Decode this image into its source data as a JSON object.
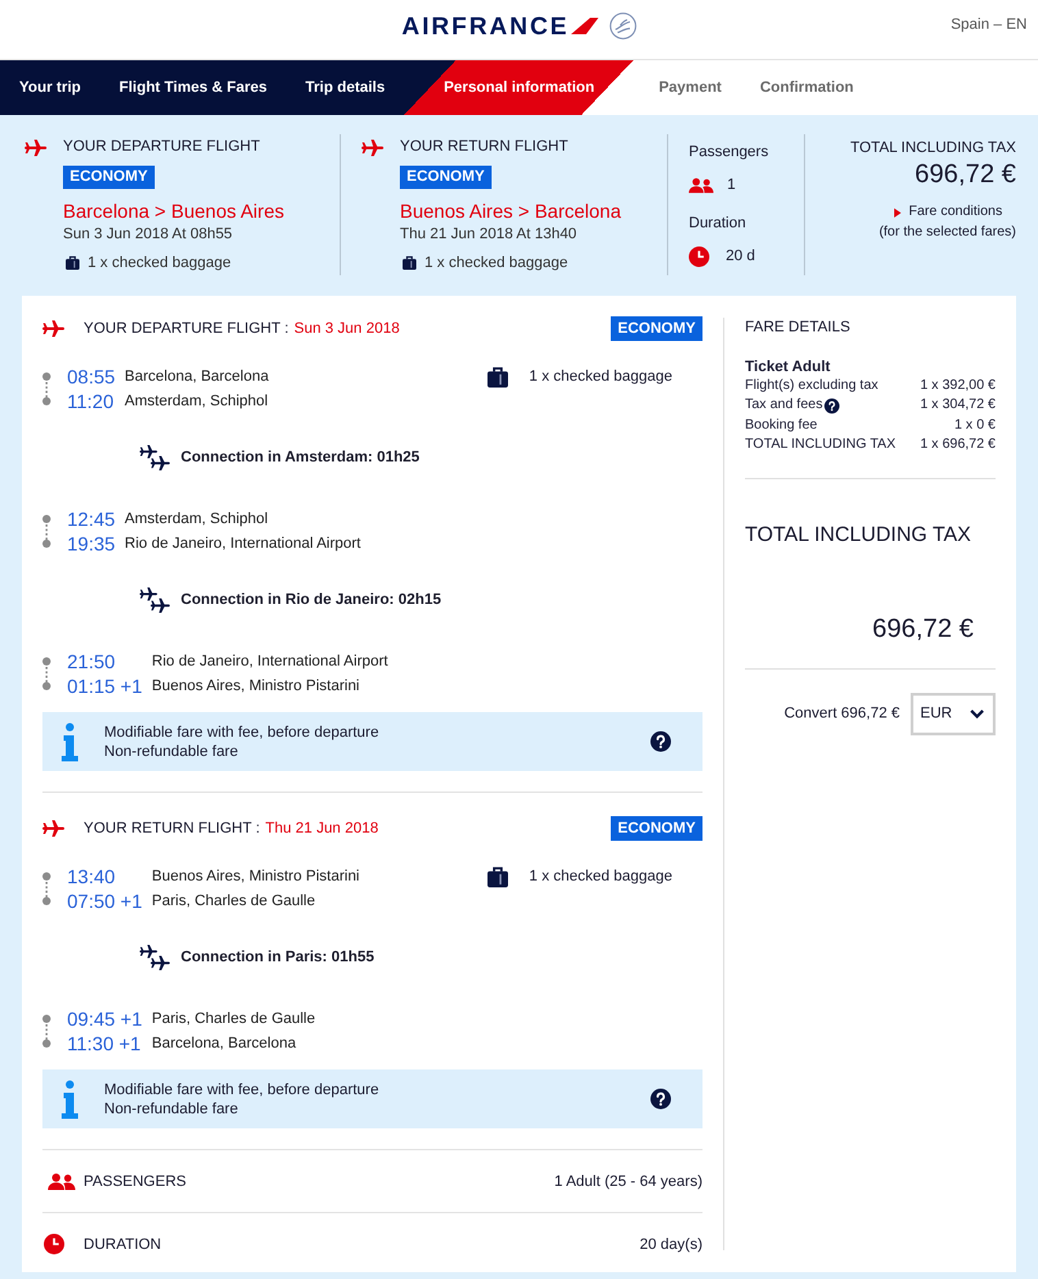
{
  "header": {
    "logo": "AIRFRANCE",
    "locale": "Spain – EN"
  },
  "steps": [
    {
      "label": "Your trip",
      "completed": true,
      "selected": false
    },
    {
      "label": "Flight Times & Fares",
      "completed": true,
      "selected": false
    },
    {
      "label": "Trip details",
      "completed": true,
      "selected": false
    },
    {
      "label": "Personal information",
      "completed": false,
      "selected": true
    },
    {
      "label": "Payment",
      "completed": false,
      "selected": false
    },
    {
      "label": "Confirmation",
      "completed": false,
      "selected": false
    }
  ],
  "summary": {
    "flights": [
      {
        "title": "YOUR DEPARTURE FLIGHT",
        "cabin": "ECONOMY",
        "route": "Barcelona > Buenos Aires",
        "date": "Sun 3 Jun 2018 At 08h55",
        "baggage": "1 x checked baggage"
      },
      {
        "title": "YOUR RETURN FLIGHT",
        "cabin": "ECONOMY",
        "route": "Buenos Aires > Barcelona",
        "date": "Thu 21 Jun 2018 At 13h40",
        "baggage": "1 x checked baggage"
      }
    ],
    "stats": [
      {
        "kind": "passengers",
        "label": "Passengers",
        "value": "1"
      },
      {
        "kind": "duration",
        "label": "Duration",
        "value": "20 d"
      }
    ],
    "total": {
      "label": "TOTAL INCLUDING TAX",
      "amount": "696,72 €",
      "link": "Fare conditions",
      "note": "(for the selected fares)"
    }
  },
  "itinerary": {
    "flights": [
      {
        "title": "YOUR DEPARTURE FLIGHT :",
        "date": "Sun 3 Jun 2018",
        "cabin": "ECONOMY",
        "baggage": "1 x checked baggage",
        "legs": [
          {
            "kind": "segment",
            "stops": [
              {
                "time": "08:55",
                "place": "Barcelona, Barcelona"
              },
              {
                "time": "11:20",
                "place": "Amsterdam, Schiphol"
              }
            ]
          },
          {
            "kind": "connection",
            "text": "Connection in Amsterdam: 01h25"
          },
          {
            "kind": "segment",
            "stops": [
              {
                "time": "12:45",
                "place": "Amsterdam, Schiphol"
              },
              {
                "time": "19:35",
                "place": "Rio de Janeiro, International Airport"
              }
            ]
          },
          {
            "kind": "connection",
            "text": "Connection in Rio de Janeiro: 02h15"
          },
          {
            "kind": "segment",
            "stops": [
              {
                "time": "21:50",
                "place": "Rio de Janeiro, International Airport"
              },
              {
                "time": "01:15 +1",
                "place": "Buenos Aires, Ministro Pistarini"
              }
            ]
          }
        ],
        "conditions": [
          "Modifiable fare with fee, before departure",
          "Non-refundable fare"
        ]
      },
      {
        "title": "YOUR RETURN FLIGHT :",
        "date": "Thu 21 Jun 2018",
        "cabin": "ECONOMY",
        "baggage": "1 x checked baggage",
        "legs": [
          {
            "kind": "segment",
            "stops": [
              {
                "time": "13:40",
                "place": "Buenos Aires, Ministro Pistarini"
              },
              {
                "time": "07:50 +1",
                "place": "Paris, Charles de Gaulle"
              }
            ]
          },
          {
            "kind": "connection",
            "text": "Connection in Paris: 01h55"
          },
          {
            "kind": "segment",
            "stops": [
              {
                "time": "09:45 +1",
                "place": "Paris, Charles de Gaulle"
              },
              {
                "time": "11:30 +1",
                "place": "Barcelona, Barcelona"
              }
            ]
          }
        ],
        "conditions": [
          "Modifiable fare with fee, before departure",
          "Non-refundable fare"
        ]
      }
    ],
    "details": [
      {
        "kind": "passengers",
        "label": "PASSENGERS",
        "value": "1 Adult (25 - 64 years)"
      },
      {
        "kind": "duration",
        "label": "DURATION",
        "value": "20 day(s)"
      }
    ]
  },
  "fare_details": {
    "title": "FARE DETAILS",
    "ticket": "Ticket Adult",
    "rows": [
      {
        "label": "Flight(s) excluding tax",
        "value": "1 x 392,00 €",
        "help": false
      },
      {
        "label": "Tax and fees",
        "value": "1 x 304,72 €",
        "help": true
      },
      {
        "label": "Booking fee",
        "value": "1 x 0 €",
        "help": false
      },
      {
        "label": "TOTAL INCLUDING TAX",
        "value": "1 x 696,72 €",
        "help": false
      }
    ],
    "total_label": "TOTAL INCLUDING TAX",
    "total_amount": "696,72 €",
    "convert_label": "Convert 696,72 €",
    "currency": "EUR"
  }
}
